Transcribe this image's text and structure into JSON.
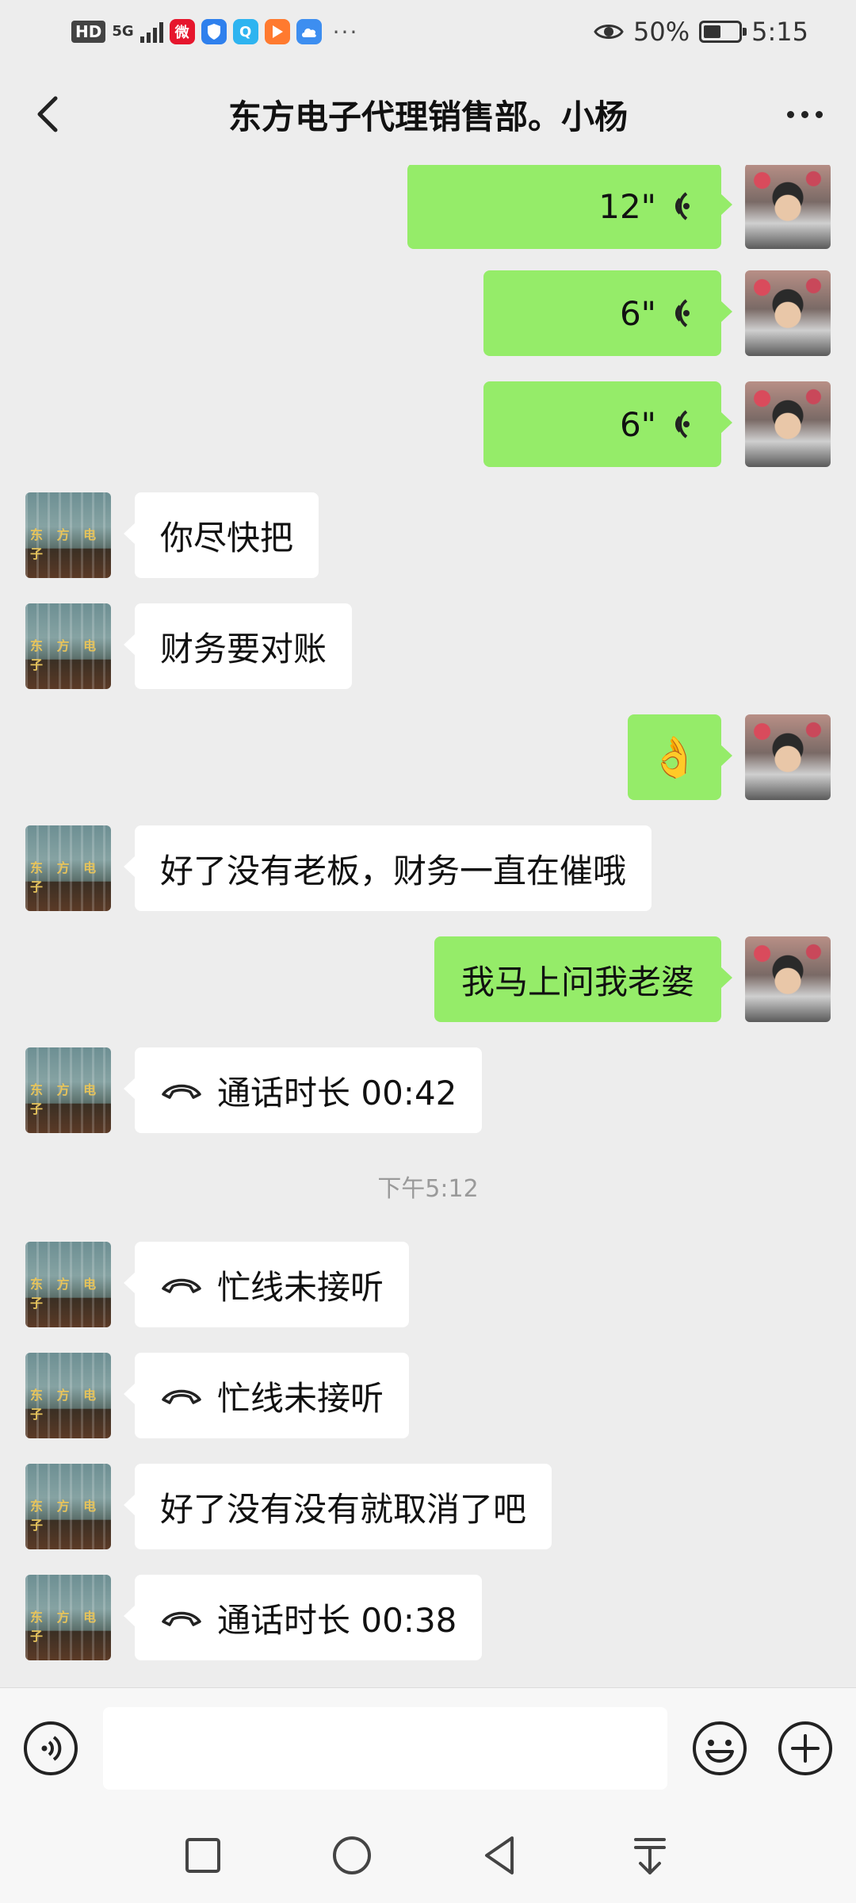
{
  "status_bar": {
    "hd": "HD",
    "network": "5G",
    "apps": [
      "weibo-icon",
      "shield-icon",
      "qq-browser-icon",
      "video-play-icon",
      "cloud-icon"
    ],
    "more": "···",
    "battery_text": "50%",
    "battery_level": 0.5,
    "time": "5:15"
  },
  "header": {
    "title": "东方电子代理销售部。小杨"
  },
  "messages": [
    {
      "from": "self",
      "type": "voice",
      "text": "12\""
    },
    {
      "from": "self",
      "type": "voice",
      "text": "6\""
    },
    {
      "from": "self",
      "type": "voice",
      "text": "6\""
    },
    {
      "from": "other",
      "type": "text",
      "text": "你尽快把"
    },
    {
      "from": "other",
      "type": "text",
      "text": "财务要对账"
    },
    {
      "from": "self",
      "type": "emoji",
      "text": "👌"
    },
    {
      "from": "other",
      "type": "text",
      "text": "好了没有老板，财务一直在催哦"
    },
    {
      "from": "self",
      "type": "text",
      "text": "我马上问我老婆"
    },
    {
      "from": "other",
      "type": "call",
      "text": "通话时长 00:42"
    },
    {
      "from": "system",
      "type": "time",
      "text": "下午5:12"
    },
    {
      "from": "other",
      "type": "call",
      "text": "忙线未接听"
    },
    {
      "from": "other",
      "type": "call",
      "text": "忙线未接听"
    },
    {
      "from": "other",
      "type": "text",
      "text": "好了没有没有就取消了吧"
    },
    {
      "from": "other",
      "type": "call",
      "text": "通话时长 00:38"
    }
  ],
  "other_avatar_sign": "东 方 电 子",
  "input": {
    "placeholder": ""
  },
  "colors": {
    "self_bubble": "#95ec69",
    "other_bubble": "#ffffff",
    "background": "#ededed"
  }
}
